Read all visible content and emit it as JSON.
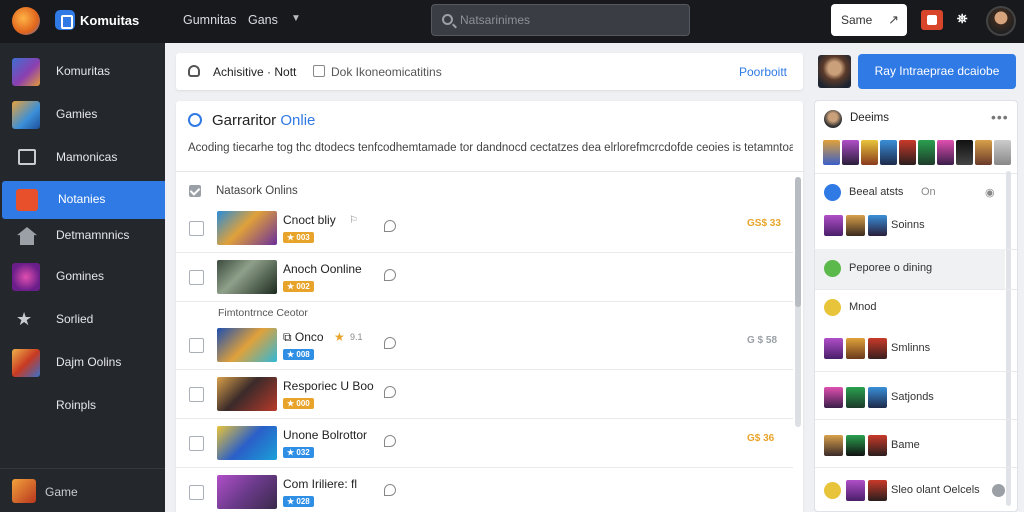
{
  "topbar": {
    "brand": "Komuitas",
    "nav": [
      "Gumnitas",
      "Gans"
    ],
    "search_placeholder": "Natsarinimes",
    "button_label": "Same"
  },
  "sidebar": {
    "items": [
      {
        "label": "Komuritas",
        "icon": "game-thumb"
      },
      {
        "label": "Gamies",
        "icon": "game-thumb"
      },
      {
        "label": "Mamonicas",
        "icon": "monitor-icon"
      },
      {
        "label": "Notanies",
        "icon": "grid-icon"
      },
      {
        "label": "Detmamnnics",
        "icon": "house-icon"
      },
      {
        "label": "Gomines",
        "icon": "game-thumb"
      },
      {
        "label": "Sorlied",
        "icon": "star-icon"
      },
      {
        "label": "Dajm Oolins",
        "icon": "game-thumb"
      },
      {
        "label": "Roinpls",
        "icon": ""
      }
    ],
    "footer_label": "Game"
  },
  "breadcrumb": {
    "title": "Achisitive · Nott",
    "sub": "Dok Ikoneomicatitins",
    "link": "Poorboitt"
  },
  "section": {
    "title": "Garraritor",
    "title_accent": "Onlie",
    "description": "Acoding tiecarhe tog thc dtodecs tenfcodhemtamade tor dandnocd cectatzes dea elrlorefmcrcdofde ceoies is tetamntoas.",
    "list_header": "Natasork Onlins"
  },
  "rows": [
    {
      "title": "Cnoct bliy",
      "badge": "★ 003",
      "badge_color": "gold",
      "price": "GS$ 33",
      "price_color": "gold",
      "pin": "⚐"
    },
    {
      "title": "Anoch Oonline",
      "badge": "★ 002",
      "badge_color": "gold",
      "price": "",
      "price_color": "gold",
      "pin": ""
    },
    {
      "title": "Onco",
      "badge": "★ 008",
      "badge_color": "blue",
      "price": "G $ 58",
      "price_color": "grey",
      "pin": "",
      "star": "★",
      "count": "9.1"
    },
    {
      "title": "Resporiec U Boo",
      "badge": "★ 000",
      "badge_color": "gold",
      "price": "",
      "price_color": "gold",
      "pin": ""
    },
    {
      "title": "Unone Bolrottor",
      "badge": "★ 032",
      "badge_color": "blue",
      "price": "G$ 36",
      "price_color": "gold",
      "pin": ""
    },
    {
      "title": "Com Iriliere: fl",
      "badge": "★ 028",
      "badge_color": "blue",
      "price": "",
      "price_color": "gold",
      "pin": ""
    }
  ],
  "subhead": "Fimtontrnce Ceotor",
  "right_panel": {
    "cta": "Ray Intraeprae dcaiobe",
    "head_title": "Deeims",
    "rows": [
      {
        "text": "Beeal atsts",
        "meta": "On"
      },
      {
        "text": "Soinns"
      },
      {
        "text": "Peporee o dining"
      },
      {
        "text": "Mnod"
      },
      {
        "text": "Smlinns"
      },
      {
        "text": "Satjonds"
      },
      {
        "text": "Bame"
      },
      {
        "text": "Sleo olant Oelcels"
      }
    ]
  },
  "colors": {
    "accent": "#2f7ae5",
    "sidebar_bg": "#24272c",
    "topbar_bg": "#17191d",
    "gold": "#e8a42a"
  }
}
